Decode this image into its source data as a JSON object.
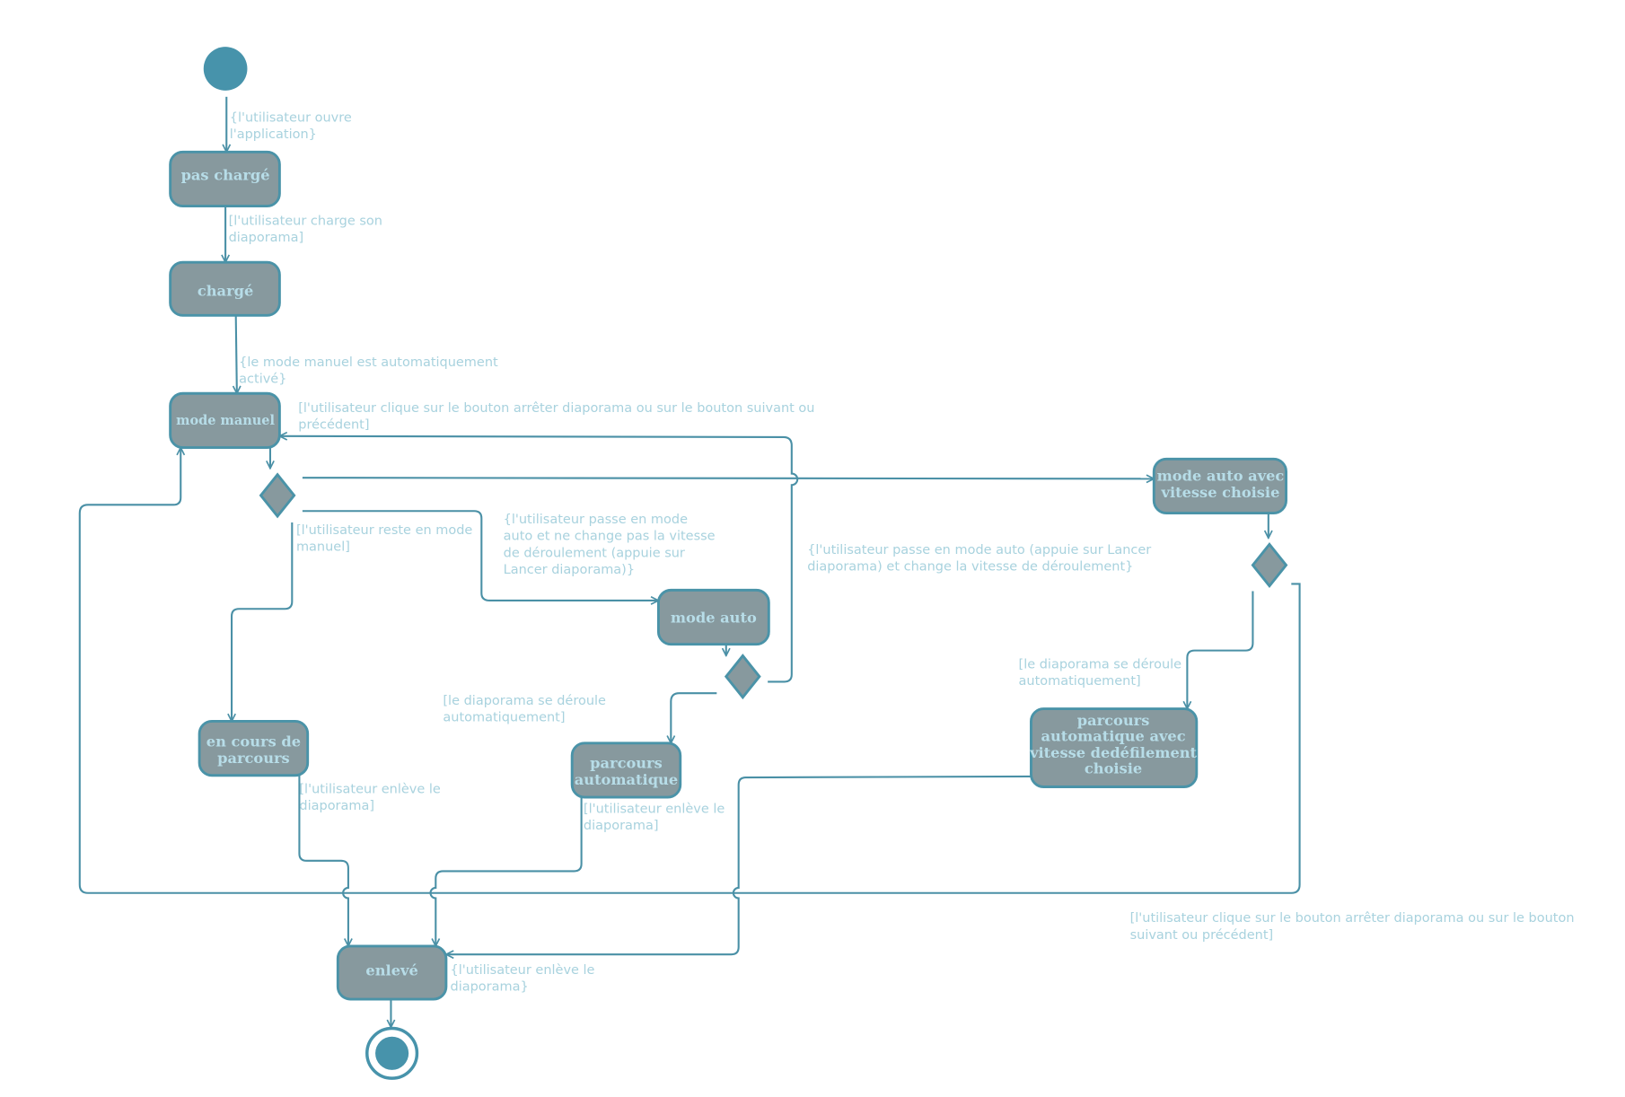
{
  "colors": {
    "state_fill": "#87999e",
    "stroke": "#4a93a8",
    "text": "#b7dde8",
    "label": "#a8d2de",
    "initial": "#4793ab"
  },
  "states": {
    "pas_charge": [
      "pas chargé"
    ],
    "charge": [
      "chargé"
    ],
    "mode_manuel": [
      "mode manuel"
    ],
    "mode_auto_vitesse": [
      "mode auto avec",
      "vitesse choisie"
    ],
    "mode_auto": [
      "mode auto"
    ],
    "en_cours": [
      "en cours de",
      "parcours"
    ],
    "parcours_auto": [
      "parcours",
      "automatique"
    ],
    "parcours_vitesse": [
      "parcours",
      "automatique avec",
      "vitesse dedéfilement",
      "choisie"
    ],
    "enleve": [
      "enlevé"
    ]
  },
  "labels": {
    "ouvre": [
      "{l'utilisateur ouvre",
      "l'application}"
    ],
    "charge": [
      "[l'utilisateur charge son",
      "diaporama]"
    ],
    "manuel_auto": [
      "{le mode manuel est automatiquement",
      "activé}"
    ],
    "arreter1": [
      "[l'utilisateur clique sur le bouton arrêter diaporama ou sur le bouton suivant ou",
      "précédent]"
    ],
    "reste": [
      "[l'utilisateur reste en mode",
      "manuel]"
    ],
    "passe_auto": [
      "{l'utilisateur passe en mode",
      "auto et ne change pas la vitesse",
      "de déroulement (appuie sur",
      "Lancer diaporama)}"
    ],
    "passe_auto_vitesse": [
      "{l'utilisateur passe en mode auto (appuie sur Lancer",
      "diaporama) et change la vitesse de déroulement}"
    ],
    "deroule1": [
      "[le diaporama se déroule",
      "automatiquement]"
    ],
    "deroule2": [
      "[le diaporama se déroule",
      "automatiquement]"
    ],
    "enleve1": [
      "[l'utilisateur enlève le",
      "diaporama]"
    ],
    "enleve2": [
      "[l'utilisateur enlève le",
      "diaporama]"
    ],
    "enleve3": [
      "{l'utilisateur enlève le",
      "diaporama}"
    ],
    "arreter2": [
      "[l'utilisateur clique sur le bouton arrêter diaporama ou sur le bouton",
      "suivant ou précédent]"
    ]
  }
}
